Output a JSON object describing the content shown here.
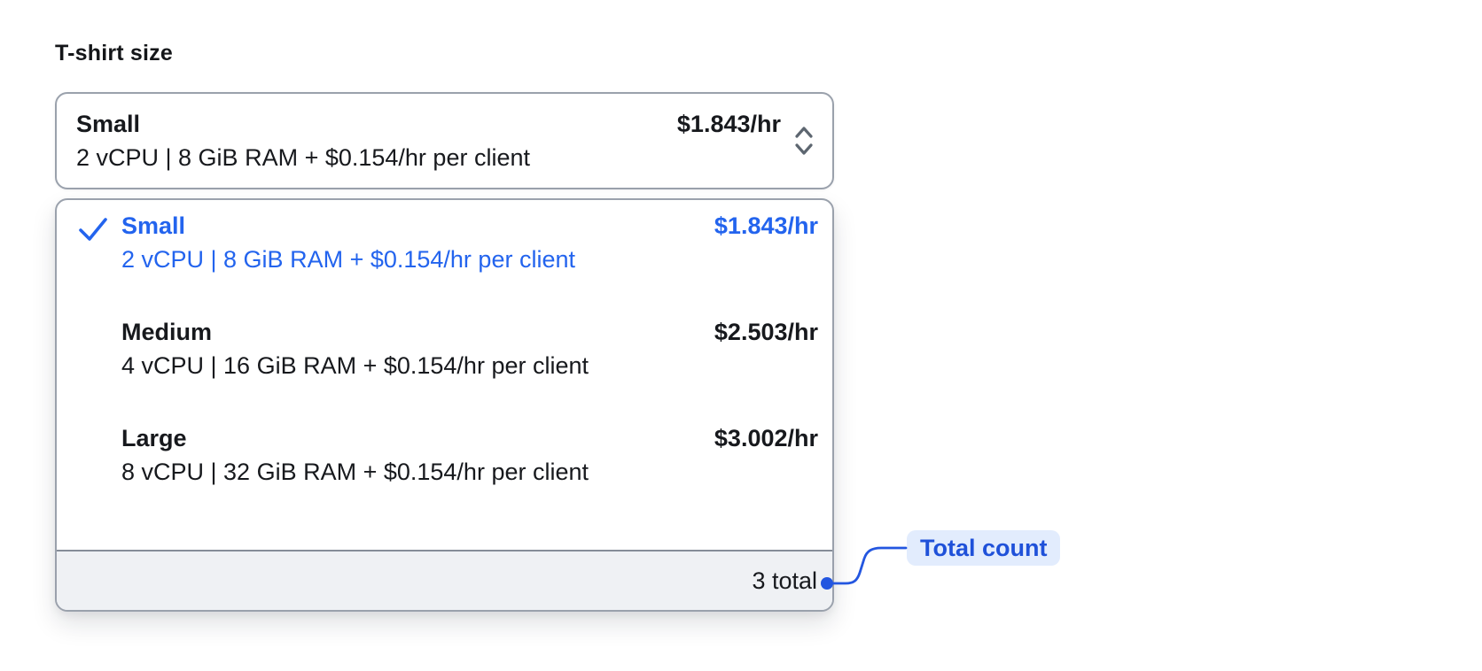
{
  "field": {
    "label": "T-shirt size"
  },
  "select": {
    "value": {
      "name": "Small",
      "description": "2 vCPU | 8 GiB RAM + $0.154/hr per client",
      "price": "$1.843/hr"
    },
    "chevron_icon": "up-down-chevrons"
  },
  "dropdown": {
    "options": [
      {
        "name": "Small",
        "description": "2 vCPU | 8 GiB RAM + $0.154/hr per client",
        "price": "$1.843/hr",
        "selected": true
      },
      {
        "name": "Medium",
        "description": "4 vCPU | 16 GiB RAM + $0.154/hr per client",
        "price": "$2.503/hr",
        "selected": false
      },
      {
        "name": "Large",
        "description": "8 vCPU | 32 GiB RAM + $0.154/hr per client",
        "price": "$3.002/hr",
        "selected": false
      }
    ],
    "footer": {
      "total_label": "3 total"
    }
  },
  "annotation": {
    "label": "Total count"
  },
  "icons": {
    "checkmark": "check-icon",
    "select_arrows": "chevron-up-down-icon"
  },
  "colors": {
    "accent_blue": "#2364ee",
    "annotation_text_blue": "#1f51d9",
    "annotation_line_blue": "#2356e0",
    "annotation_bg": "#e2ecfd",
    "text": "#17191d",
    "border_gray": "#9aa1ac",
    "footer_separator": "#868d98",
    "footer_bg": "#eff1f4",
    "chevron_gray": "#5d6670"
  }
}
